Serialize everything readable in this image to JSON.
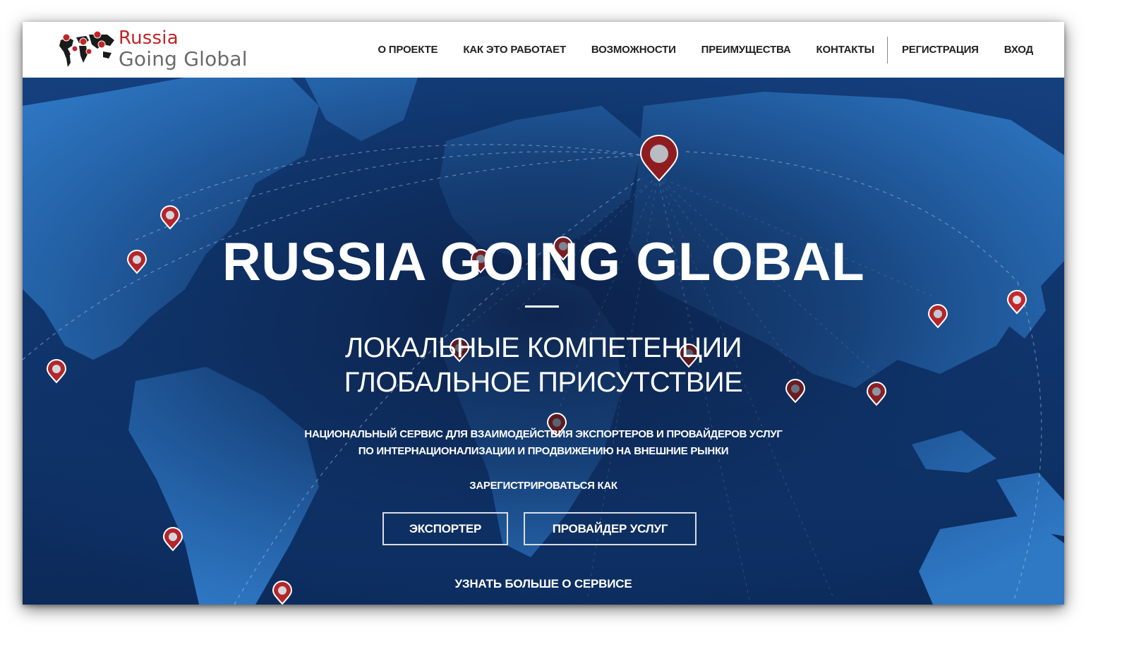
{
  "logo": {
    "line1": "Russia",
    "line2": "Going Global"
  },
  "nav": {
    "items": [
      "О ПРОЕКТЕ",
      "КАК ЭТО РАБОТАЕТ",
      "ВОЗМОЖНОСТИ",
      "ПРЕИМУЩЕСТВА",
      "КОНТАКТЫ"
    ],
    "register": "РЕГИСТРАЦИЯ",
    "login": "ВХОД"
  },
  "hero": {
    "title": "RUSSIA GOING GLOBAL",
    "subtitle_line1": "ЛОКАЛЬНЫЕ КОМПЕТЕНЦИИ",
    "subtitle_line2": "ГЛОБАЛЬНОЕ ПРИСУТСТВИЕ",
    "description_line1": "НАЦИОНАЛЬНЫЙ СЕРВИС ДЛЯ ВЗАИМОДЕЙСТВИЯ ЭКСПОРТЕРОВ И ПРОВАЙДЕРОВ УСЛУГ",
    "description_line2": "ПО ИНТЕРНАЦИОНАЛИЗАЦИИ И ПРОДВИЖЕНИЮ НА ВНЕШНИЕ РЫНКИ",
    "register_as": "ЗАРЕГИСТРИРОВАТЬСЯ КАК",
    "exporter_button": "ЭКСПОРТЕР",
    "provider_button": "ПРОВАЙДЕР УСЛУГ",
    "learn_more": "УЗНАТЬ БОЛЬШЕ О СЕРВИСЕ"
  },
  "colors": {
    "brand_red": "#c22428",
    "brand_gray": "#6a6a6a",
    "hero_bg_dark": "#0b1f45",
    "hero_land": "#2f78c4"
  }
}
